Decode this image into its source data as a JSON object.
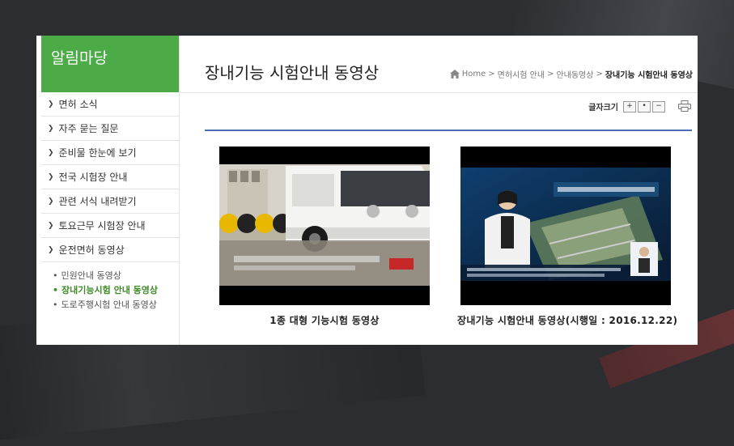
{
  "sidebar": {
    "title": "알림마당",
    "menu": [
      {
        "label": "면허 소식"
      },
      {
        "label": "자주 묻는 질문"
      },
      {
        "label": "준비물 한눈에 보기"
      },
      {
        "label": "전국 시험장 안내"
      },
      {
        "label": "관련 서식 내려받기"
      },
      {
        "label": "토요근무 시험장 안내"
      },
      {
        "label": "운전면허 동영상"
      }
    ],
    "submenu": [
      {
        "label": "민원안내 동영상"
      },
      {
        "label": "장내기능시험 안내 동영상"
      },
      {
        "label": "도로주행시험 안내 동영상"
      }
    ]
  },
  "page": {
    "title": "장내기능 시험안내 동영상"
  },
  "breadcrumb": {
    "home": "Home",
    "items": [
      "면허시험 안내",
      "안내동영상"
    ],
    "current": "장내기능 시험안내 동영상",
    "separator": ">"
  },
  "font_size": {
    "label": "글자크기",
    "plus": "+",
    "reset": "•",
    "minus": "−"
  },
  "videos": [
    {
      "title": "1종 대형 기능시험 동영상",
      "overlay_badge": "금지"
    },
    {
      "title": "장내기능 시험안내 동영상(시행일 : 2016.12.22)",
      "overlay_caption": "개선된 운전면허 장내기능시험"
    }
  ],
  "colors": {
    "accent_green": "#4cab47",
    "active_green": "#3d8b27",
    "divider_blue": "#4a6fb5"
  }
}
